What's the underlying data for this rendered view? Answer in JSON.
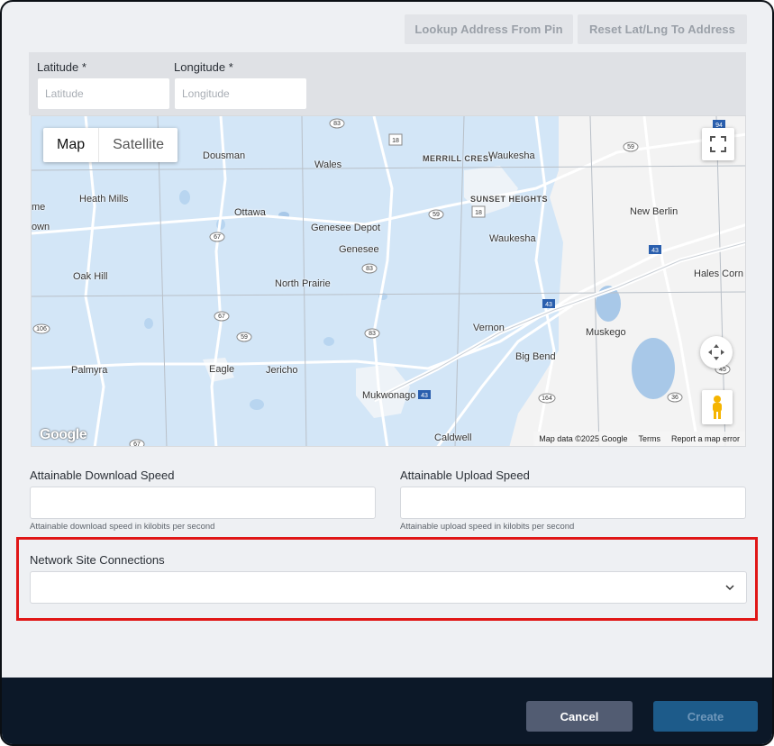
{
  "toolbar": {
    "lookup_label": "Lookup Address From Pin",
    "reset_label": "Reset Lat/Lng To Address"
  },
  "coordinates": {
    "latitude_label": "Latitude",
    "longitude_label": "Longitude",
    "required_mark": "*",
    "latitude_placeholder": "Latitude",
    "longitude_placeholder": "Longitude"
  },
  "map": {
    "type_map": "Map",
    "type_satellite": "Satellite",
    "logo": "Google",
    "attribution": "Map data ©2025 Google",
    "terms": "Terms",
    "report": "Report a map error",
    "places": {
      "dousman": "Dousman",
      "wales": "Wales",
      "merrill_crest": "MERRILL CREST",
      "waukesha_top": "Waukesha",
      "heath_mills": "Heath Mills",
      "ottawa": "Ottawa",
      "genesee_depot": "Genesee Depot",
      "sunset_heights": "SUNSET HEIGHTS",
      "new_berlin": "New Berlin",
      "waukesha": "Waukesha",
      "genesee": "Genesee",
      "oak_hill": "Oak Hill",
      "north_prairie": "North Prairie",
      "hales_corners": "Hales Corn",
      "vernon": "Vernon",
      "muskego": "Muskego",
      "palmyra": "Palmyra",
      "eagle": "Eagle",
      "jericho": "Jericho",
      "big_bend": "Big Bend",
      "mukwonago": "Mukwonago",
      "caldwell": "Caldwell",
      "edge_me": "me",
      "edge_own": "own"
    },
    "shields": {
      "r83a": "83",
      "r18a": "18",
      "r59a": "59",
      "r94": "94",
      "r59b": "59",
      "r18b": "18",
      "r67a": "67",
      "r43a": "43",
      "r83b": "83",
      "r67b": "67",
      "r59c": "59",
      "r43b": "43",
      "r106": "106",
      "r83c": "83",
      "r45": "45",
      "r43c": "43",
      "r164": "164",
      "r36": "36",
      "r67c": "67"
    }
  },
  "speeds": {
    "download_label": "Attainable Download Speed",
    "download_help": "Attainable download speed in kilobits per second",
    "upload_label": "Attainable Upload Speed",
    "upload_help": "Attainable upload speed in kilobits per second"
  },
  "connections": {
    "label": "Network Site Connections"
  },
  "footer": {
    "cancel_label": "Cancel",
    "create_label": "Create"
  },
  "colors": {
    "accent_highlight": "#e01616",
    "footer_bg": "#0c1828",
    "cancel_bg": "#525c72",
    "create_bg": "#1d5b8a"
  }
}
